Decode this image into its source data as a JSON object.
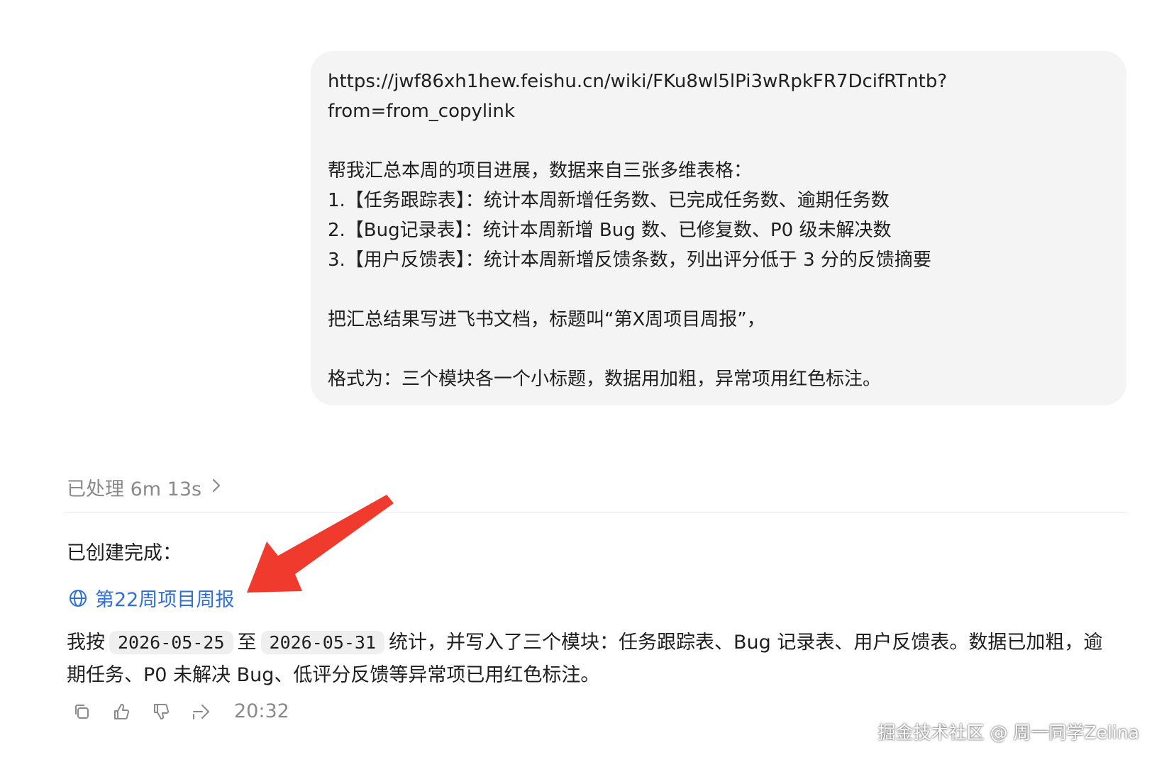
{
  "user_message": {
    "url_line1": "https://jwf86xh1hew.feishu.cn/wiki/FKu8wl5lPi3wRpkFR7DcifRTntb?",
    "url_line2": "from=from_copylink",
    "intro": "帮我汇总本周的项目进展，数据来自三张多维表格：",
    "item1": "1.【任务跟踪表】：统计本周新增任务数、已完成任务数、逾期任务数",
    "item2": "2.【Bug记录表】：统计本周新增 Bug 数、已修复数、P0 级未解决数",
    "item3": "3.【用户反馈表】：统计本周新增反馈条数，列出评分低于 3 分的反馈摘要",
    "title_req": "把汇总结果写进飞书文档，标题叫“第X周项目周报”，",
    "format_req": "格式为：三个模块各一个小标题，数据用加粗，异常项用红色标注。"
  },
  "assistant": {
    "processed_label": "已处理 6m 13s",
    "created_label": "已创建完成：",
    "doc_link": "第22周项目周报",
    "result_prefix": "我按",
    "date_start": "2026-05-25",
    "result_mid": "至",
    "date_end": "2026-05-31",
    "result_suffix": "统计，并写入了三个模块：任务跟踪表、Bug 记录表、用户反馈表。数据已加粗，逾期任务、P0 未解决 Bug、低评分反馈等异常项已用红色标注。",
    "time": "20:32"
  },
  "icons": {
    "copy": "copy-icon",
    "like": "thumbs-up-icon",
    "dislike": "thumbs-down-icon",
    "share": "share-icon",
    "globe": "globe-icon",
    "chevron": "chevron-right-icon"
  },
  "colors": {
    "link": "#2e6fd9",
    "annotation_arrow": "#f03a2e",
    "bubble_bg": "#f4f4f5",
    "muted": "#8a8a8a"
  },
  "watermark": "掘金技术社区 @ 周一同学Zelina"
}
